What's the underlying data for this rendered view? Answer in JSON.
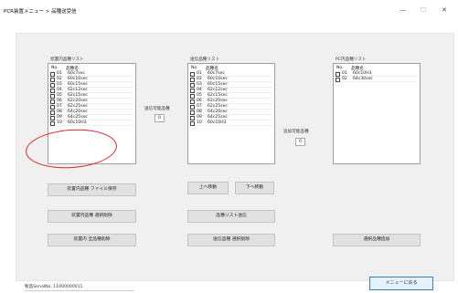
{
  "window": {
    "title": "PCR装置メニュー > 品種送受信",
    "minimize_glyph": "—",
    "maximize_glyph": "☐",
    "close_glyph": "✕"
  },
  "lists": {
    "device": {
      "label": "装置内品種リスト",
      "col_no": "No.",
      "col_name": "品種名",
      "rows": [
        {
          "no": "01",
          "name": "60c7sec"
        },
        {
          "no": "02",
          "name": "60c10sec"
        },
        {
          "no": "03",
          "name": "60c15sec"
        },
        {
          "no": "04",
          "name": "62c12sec"
        },
        {
          "no": "05",
          "name": "62c15sec"
        },
        {
          "no": "06",
          "name": "62c20sec"
        },
        {
          "no": "07",
          "name": "62c25sec"
        },
        {
          "no": "08",
          "name": "64c20sec"
        },
        {
          "no": "09",
          "name": "64c25sec"
        },
        {
          "no": "10",
          "name": "60c10H3"
        }
      ]
    },
    "send": {
      "label": "送信品種リスト",
      "col_no": "No.",
      "col_name": "品種名",
      "rows": [
        {
          "no": "01",
          "name": "60c7sec"
        },
        {
          "no": "02",
          "name": "60c10sec"
        },
        {
          "no": "03",
          "name": "60c15sec"
        },
        {
          "no": "04",
          "name": "62c12sec"
        },
        {
          "no": "05",
          "name": "62c15sec"
        },
        {
          "no": "06",
          "name": "62c20sec"
        },
        {
          "no": "07",
          "name": "62c25sec"
        },
        {
          "no": "08",
          "name": "64c20sec"
        },
        {
          "no": "09",
          "name": "64c25sec"
        },
        {
          "no": "10",
          "name": "60c10H3"
        }
      ]
    },
    "pc": {
      "label": "PC内品種リスト",
      "col_no": "No.",
      "col_name": "品種名",
      "rows": [
        {
          "no": "01",
          "name": "60c10H3"
        },
        {
          "no": "02",
          "name": "64c30sec"
        }
      ]
    }
  },
  "counters": {
    "sendable_label": "送信可能品種",
    "sendable_value": "0",
    "addable_label": "追加可能品種",
    "addable_value": "0"
  },
  "buttons": {
    "save_device_file": "装置内品種 ファイル保存",
    "delete_device_selected": "装置内品種 選択削除",
    "delete_device_all": "装置内 全品種削除",
    "move_up": "上へ移動",
    "move_down": "下へ移動",
    "send_list": "品種リスト送信",
    "delete_send_selected": "送信品種 選択削除",
    "add_selected": "選択品種追加",
    "back_to_menu": "メニューに戻る"
  },
  "footer": {
    "serial": "製品SerialNo. 11000000011"
  },
  "annotation_color": "#e0222a"
}
